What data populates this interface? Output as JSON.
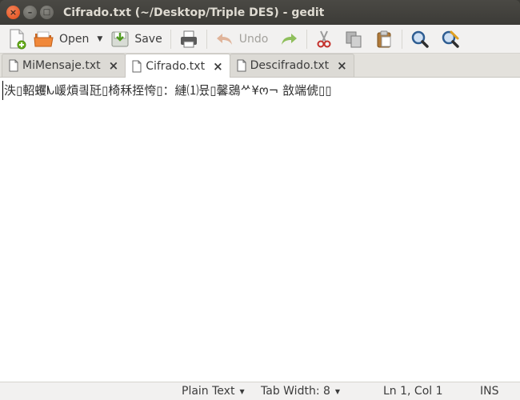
{
  "window": {
    "title": "Cifrado.txt (~/Desktop/Triple DES) - gedit",
    "close_glyph": "×",
    "minimize_glyph": "–",
    "maximize_glyph": "□"
  },
  "toolbar": {
    "new_icon": "new-document-icon",
    "open_label": "Open",
    "open_dropdown_glyph": "▼",
    "save_label": "Save",
    "print_icon": "print-icon",
    "undo_label": "Undo",
    "redo_icon": "redo-icon",
    "cut_icon": "cut-icon",
    "copy_icon": "copy-icon",
    "paste_icon": "paste-icon",
    "find_icon": "find-icon",
    "replace_icon": "find-replace-icon"
  },
  "tabs": [
    {
      "label": "MiMensaje.txt",
      "active": false,
      "close_glyph": "×"
    },
    {
      "label": "Cifrado.txt",
      "active": true,
      "close_glyph": "×"
    },
    {
      "label": "Descifrado.txt",
      "active": false,
      "close_glyph": "×"
    }
  ],
  "editor": {
    "content": "泆▯軺蠼ᗃ嵈熕킠瓩▯椅秝挃恗▯：縺⑴뮸▯馨鵋ᄽ¥ო¬ 敨端俿▯▯"
  },
  "statusbar": {
    "language": "Plain Text",
    "tab_width": "Tab Width: 8",
    "position": "Ln 1, Col 1",
    "mode": "INS",
    "dropdown_glyph": "▼"
  },
  "colors": {
    "titlebar": "#3c3b37",
    "close_button": "#df4a16",
    "toolbar_bg": "#f2f1f0",
    "editor_bg": "#ffffff"
  }
}
